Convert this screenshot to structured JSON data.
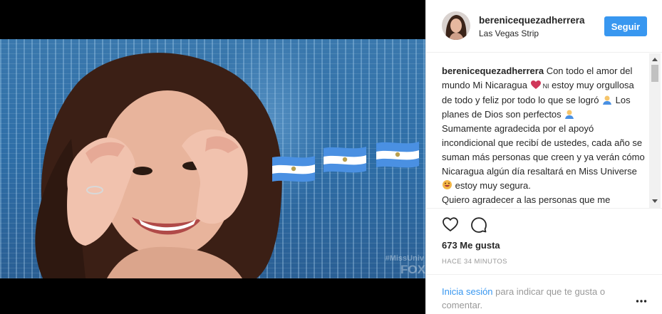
{
  "post": {
    "media": {
      "watermark_tag": "#MissUniv",
      "watermark_logo": "FOX"
    },
    "header": {
      "username": "berenicequezadherrera",
      "location": "Las Vegas Strip",
      "follow_label": "Seguir"
    },
    "caption": {
      "username": "berenicequezadherrera",
      "l1": " Con todo el amor del mundo Mi Nicaragua ",
      "l1_tag": "NI",
      "l2": " estoy muy orgullosa de todo y feliz por todo lo que se logró ",
      "l3": " Los planes de Dios son perfectos ",
      "p2": "Sumamente agradecida por el apoyó incondicional que recibí de ustedes, cada año se suman más personas que creen y ya verán cómo Nicaragua algún día resaltará en Miss Universe ",
      "p2_end": " estoy muy segura.",
      "p3": "Quiero agradecer a las personas que me apoyaron de corazón y..."
    },
    "actions": {
      "likes": "673 Me gusta",
      "timestamp": "HACE 34 MINUTOS"
    },
    "footer": {
      "login_link": "Inicia sesión",
      "login_text": " para indicar que te gusta o comentar."
    },
    "colors": {
      "accent": "#3897f0",
      "muted": "#999999",
      "text": "#262626"
    },
    "icons": [
      "heart-outline-icon",
      "comment-bubble-icon",
      "more-options-icon",
      "heart-emoji-icon",
      "praying-hands-emoji-icon",
      "smiling-emoji-icon",
      "nicaragua-flag-icon"
    ]
  }
}
